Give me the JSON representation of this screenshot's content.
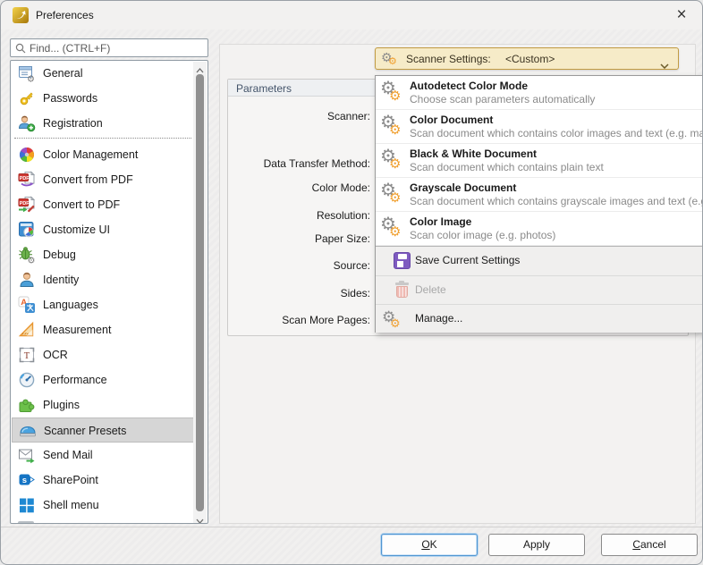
{
  "titlebar": {
    "title": "Preferences",
    "close_glyph": "×"
  },
  "icons": {
    "gear": "⚙"
  },
  "sidebar": {
    "search_placeholder": "Find... (CTRL+F)",
    "items": [
      {
        "label": "General"
      },
      {
        "label": "Passwords"
      },
      {
        "label": "Registration"
      },
      {
        "label": "Color Management"
      },
      {
        "label": "Convert from PDF"
      },
      {
        "label": "Convert to PDF"
      },
      {
        "label": "Customize UI"
      },
      {
        "label": "Debug"
      },
      {
        "label": "Identity"
      },
      {
        "label": "Languages"
      },
      {
        "label": "Measurement"
      },
      {
        "label": "OCR"
      },
      {
        "label": "Performance"
      },
      {
        "label": "Plugins"
      },
      {
        "label": "Scanner Presets"
      },
      {
        "label": "Send Mail"
      },
      {
        "label": "SharePoint"
      },
      {
        "label": "Shell menu"
      }
    ],
    "selected": "Scanner Presets"
  },
  "parameters": {
    "title": "Parameters",
    "fields": [
      "Scanner:",
      "Data Transfer Method:",
      "Color Mode:",
      "Resolution:",
      "Paper Size:",
      "Source:",
      "Sides:",
      "Scan More Pages:"
    ]
  },
  "scanner_settings": {
    "label": "Scanner Settings:",
    "value": "<Custom>"
  },
  "presets_menu": {
    "items": [
      {
        "title": "Autodetect Color Mode",
        "subtitle": "Choose scan parameters automatically"
      },
      {
        "title": "Color Document",
        "subtitle": "Scan document which contains color images and text (e.g. ma"
      },
      {
        "title": "Black & White Document",
        "subtitle": "Scan document which contains plain text"
      },
      {
        "title": "Grayscale Document",
        "subtitle": "Scan document which contains grayscale images and text (e.g"
      },
      {
        "title": "Color Image",
        "subtitle": "Scan color image (e.g. photos)"
      }
    ],
    "actions": [
      {
        "label": "Save Current Settings",
        "enabled": true
      },
      {
        "label": "Delete",
        "enabled": false
      },
      {
        "label": "Manage...",
        "enabled": true
      }
    ]
  },
  "footer": {
    "ok_key": "O",
    "ok_rest": "K",
    "apply": "Apply",
    "cancel_key": "C",
    "cancel_rest": "ancel"
  },
  "colors": {
    "accent_gold_bg": "#f6ebc8",
    "accent_gold_border": "#c19b42",
    "selected_item_bg": "#d6d6d6",
    "menu_subtitle": "#8a8a8a",
    "focus_blue": "#4f95d1",
    "disabled_text": "#a8a8a8"
  }
}
